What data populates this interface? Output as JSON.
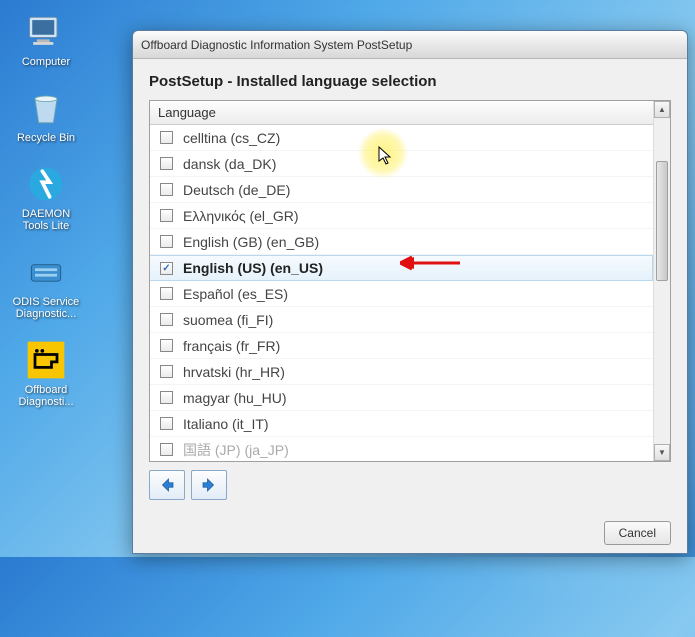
{
  "desktop": {
    "icons": [
      {
        "name": "computer-icon",
        "label": "Computer"
      },
      {
        "name": "recycle-bin-icon",
        "label": "Recycle Bin"
      },
      {
        "name": "daemon-tools-icon",
        "label": "DAEMON Tools Lite"
      },
      {
        "name": "odis-service-icon",
        "label": "ODIS Service Diagnostic..."
      },
      {
        "name": "offboard-diag-icon",
        "label": "Offboard Diagnosti..."
      }
    ]
  },
  "window": {
    "title": "Offboard Diagnostic Information System PostSetup",
    "section_title": "PostSetup - Installed language selection",
    "list_header": "Language",
    "languages": [
      {
        "label": "celltina (cs_CZ)",
        "checked": false,
        "selected": false
      },
      {
        "label": "dansk (da_DK)",
        "checked": false,
        "selected": false
      },
      {
        "label": "Deutsch (de_DE)",
        "checked": false,
        "selected": false
      },
      {
        "label": "Ελληνικός (el_GR)",
        "checked": false,
        "selected": false
      },
      {
        "label": "English (GB) (en_GB)",
        "checked": false,
        "selected": false
      },
      {
        "label": "English (US)  (en_US)",
        "checked": true,
        "selected": true
      },
      {
        "label": "Español (es_ES)",
        "checked": false,
        "selected": false
      },
      {
        "label": "suomea (fi_FI)",
        "checked": false,
        "selected": false
      },
      {
        "label": "français (fr_FR)",
        "checked": false,
        "selected": false
      },
      {
        "label": "hrvatski (hr_HR)",
        "checked": false,
        "selected": false
      },
      {
        "label": "magyar (hu_HU)",
        "checked": false,
        "selected": false
      },
      {
        "label": "Italiano (it_IT)",
        "checked": false,
        "selected": false
      },
      {
        "label": "国語 (JP) (ja_JP)",
        "checked": false,
        "selected": false,
        "partial": true
      }
    ],
    "cancel_label": "Cancel"
  },
  "colors": {
    "arrow_blue": "#2b7fd4",
    "arrow_red": "#e01010"
  }
}
